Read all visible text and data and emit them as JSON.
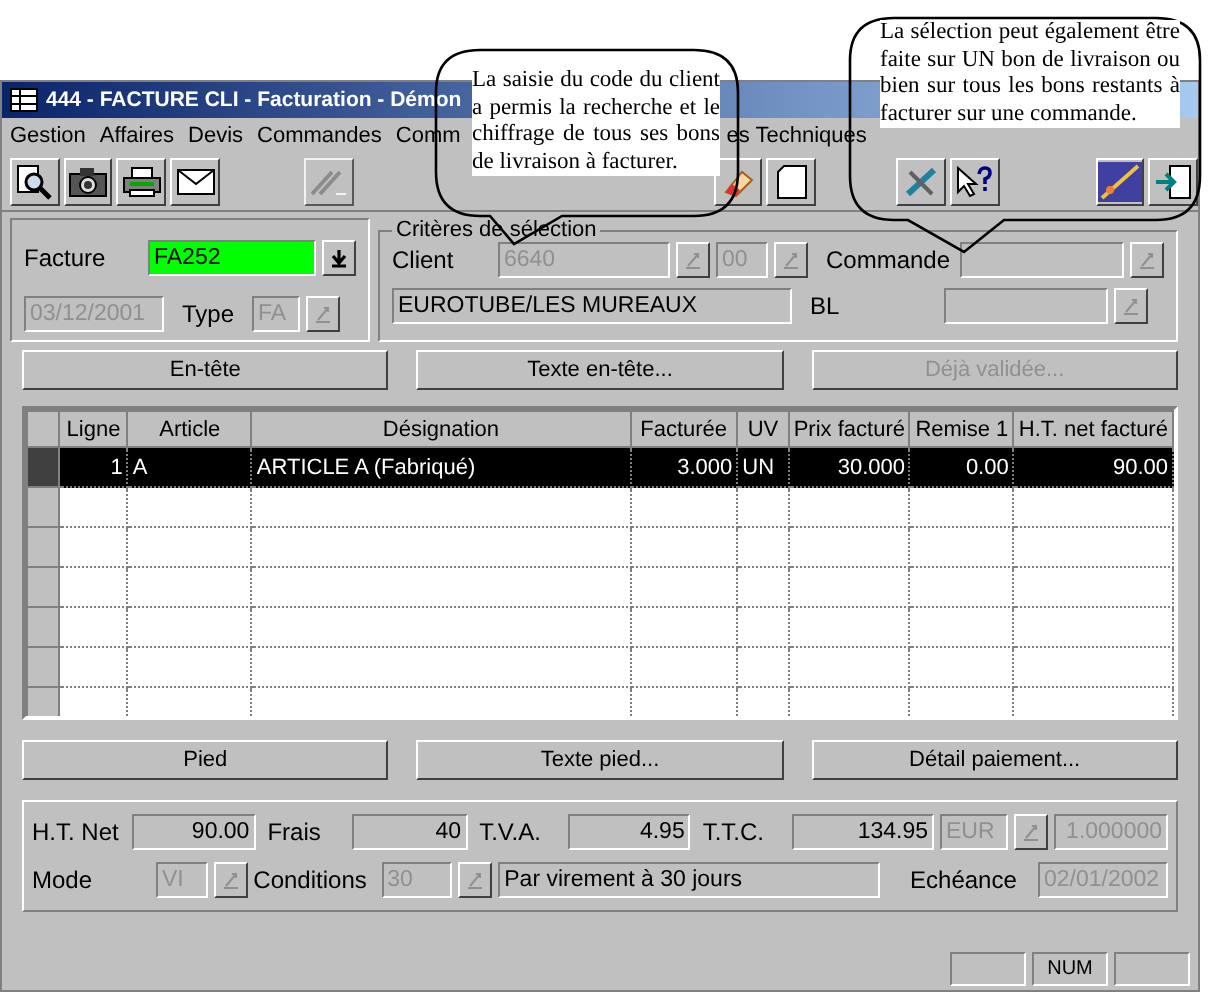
{
  "window": {
    "title": "444 - FACTURE CLI - Facturation - Démon"
  },
  "menu": [
    {
      "label": "Gestion",
      "disabled": false
    },
    {
      "label": "Affaires",
      "disabled": false
    },
    {
      "label": "Devis",
      "disabled": false
    },
    {
      "label": "Commandes",
      "disabled": false
    },
    {
      "label": "Comm",
      "disabled": false
    },
    {
      "label": "es Techniques",
      "disabled": false
    }
  ],
  "toolbar": [
    {
      "kind": "search",
      "disabled": false
    },
    {
      "kind": "camera",
      "disabled": false
    },
    {
      "kind": "printer",
      "disabled": false
    },
    {
      "kind": "mail",
      "disabled": false
    },
    {
      "kind": "pen",
      "disabled": true
    },
    {
      "kind": "eraser",
      "disabled": false
    },
    {
      "kind": "page",
      "disabled": false
    },
    {
      "kind": "tools",
      "disabled": false
    },
    {
      "kind": "help",
      "disabled": false
    },
    {
      "kind": "picture",
      "disabled": false
    },
    {
      "kind": "exit",
      "disabled": false
    }
  ],
  "callouts": [
    "La saisie du code du client a permis la recherche et le chiffrage de tous ses bons de livraison à facturer.",
    "La sélection peut également être faite sur UN bon de livraison ou bien sur tous les bons restants à facturer sur une commande."
  ],
  "invoice": {
    "label": "Facture",
    "value": "FA252",
    "date": "03/12/2001",
    "type_label": "Type",
    "type_value": "FA"
  },
  "criteria": {
    "title": "Critères de sélection",
    "client_label": "Client",
    "client_code": "6640",
    "client_suffix": "00",
    "client_name": "EUROTUBE/LES MUREAUX",
    "order_label": "Commande",
    "bl_label": "BL"
  },
  "header_buttons": [
    {
      "label": "En-tête",
      "disabled": false
    },
    {
      "label": "Texte en-tête...",
      "disabled": false
    },
    {
      "label": "Déjà validée...",
      "disabled": true
    }
  ],
  "table": {
    "columns": [
      "Ligne",
      "Article",
      "Désignation",
      "Facturée",
      "UV",
      "Prix facturé",
      "Remise 1",
      "H.T. net facturé"
    ],
    "rows": [
      {
        "cells": [
          "1",
          "A",
          "ARTICLE A (Fabriqué)",
          "3.000",
          "UN",
          "30.000",
          "0.00",
          "90.00"
        ],
        "selected": true
      }
    ]
  },
  "footer_buttons": [
    {
      "label": "Pied",
      "disabled": false
    },
    {
      "label": "Texte pied...",
      "disabled": false
    },
    {
      "label": "Détail paiement...",
      "disabled": false
    }
  ],
  "totals": {
    "ht_label": "H.T. Net",
    "ht": "90.00",
    "frais_label": "Frais",
    "frais": "40",
    "tva_label": "T.V.A.",
    "tva": "4.95",
    "ttc_label": "T.T.C.",
    "ttc": "134.95",
    "currency": "EUR",
    "rate": "1.000000"
  },
  "payment": {
    "mode_label": "Mode",
    "mode": "VI",
    "conditions_label": "Conditions",
    "conditions": "30",
    "conditions_text": "Par virement à 30 jours",
    "due_label": "Echéance",
    "due": "02/01/2002"
  },
  "status_bar": {
    "num": "NUM"
  }
}
